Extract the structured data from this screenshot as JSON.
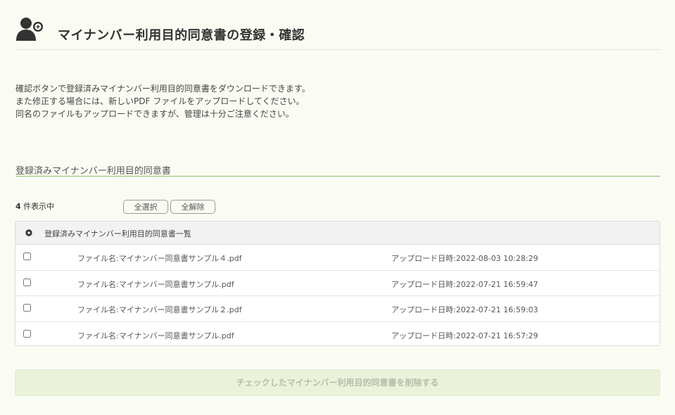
{
  "header": {
    "title": "マイナンバー利用目的同意書の登録・確認",
    "icon": "user-add-icon"
  },
  "intro": {
    "lines": [
      "確認ボタンで登録済みマイナンバー利用目的同意書をダウンロードできます。",
      "また修正する場合には、新しいPDF ファイルをアップロードしてください。",
      "同名のファイルもアップロードできますが、管理は十分ご注意ください。"
    ]
  },
  "section": {
    "title": "登録済みマイナンバー利用目的同意書"
  },
  "toolbar": {
    "count_number": "4",
    "count_suffix": " 件表示中",
    "select_all_label": "全選択",
    "deselect_all_label": "全解除"
  },
  "list": {
    "header_label": "登録済みマイナンバー利用目的同意書一覧",
    "header_icon": "gear-icon",
    "rows": [
      {
        "file": "ファイル名:マイナンバー同意書サンプル４.pdf",
        "date": "アップロード日時:2022-08-03 10:28:29",
        "checked": false
      },
      {
        "file": "ファイル名:マイナンバー同意書サンプル.pdf",
        "date": "アップロード日時:2022-07-21 16:59:47",
        "checked": false
      },
      {
        "file": "ファイル名:マイナンバー同意書サンプル２.pdf",
        "date": "アップロード日時:2022-07-21 16:59:03",
        "checked": false
      },
      {
        "file": "ファイル名:マイナンバー同意書サンプル.pdf",
        "date": "アップロード日時:2022-07-21 16:57:29",
        "checked": false
      }
    ]
  },
  "actions": {
    "delete_label": "チェックしたマイナンバー利用目的同意書を削除する"
  },
  "colors": {
    "background": "#fafcf3",
    "accent_line": "#8ec06a",
    "delete_bg": "#eaf3d9",
    "delete_text": "#b5bca9"
  }
}
